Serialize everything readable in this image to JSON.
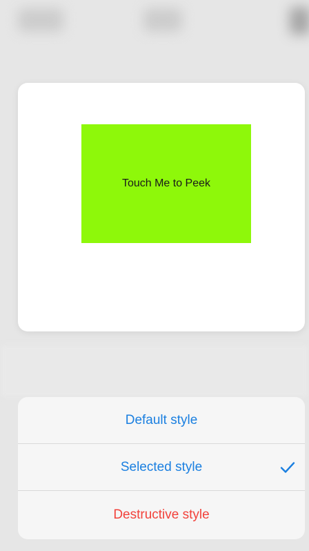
{
  "colors": {
    "accent": "#1a7fe0",
    "destructive": "#f2423b",
    "preview_fill": "#8ef80a"
  },
  "preview": {
    "label": "Touch Me to Peek"
  },
  "actions": [
    {
      "label": "Default style",
      "style": "default",
      "selected": false
    },
    {
      "label": "Selected style",
      "style": "selected",
      "selected": true,
      "icon": "checkmark-icon"
    },
    {
      "label": "Destructive style",
      "style": "destructive",
      "selected": false
    }
  ]
}
